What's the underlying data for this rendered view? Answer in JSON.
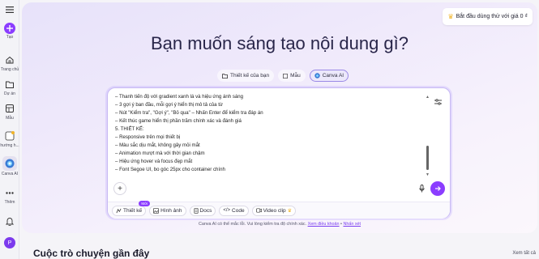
{
  "sidebar": {
    "items": [
      {
        "label": "Tạo",
        "icon": "plus-icon"
      },
      {
        "label": "Trang chủ",
        "icon": "home-icon"
      },
      {
        "label": "Dự án",
        "icon": "folder-icon"
      },
      {
        "label": "Mẫu",
        "icon": "template-icon"
      },
      {
        "label": "hướng h...",
        "icon": "brand-icon"
      },
      {
        "label": "Canva AI",
        "icon": "canva-ai-icon"
      },
      {
        "label": "Thêm",
        "icon": "more-icon"
      }
    ],
    "avatar_initial": "P"
  },
  "header": {
    "trial_button": "Bắt đầu dùng thử với giá 0 ₫",
    "title": "Bạn muốn sáng tạo nội dung gì?"
  },
  "tabs": [
    {
      "label": "Thiết kế của bạn"
    },
    {
      "label": "Mẫu"
    },
    {
      "label": "Canva AI"
    }
  ],
  "composer": {
    "lines": [
      "– Thanh tiến độ với gradient xanh lá và hiệu ứng ánh sáng",
      "– 3 gợi ý ban đầu, mỗi gợi ý hiển thị mô tả của từ",
      "– Nút \"Kiểm tra\", \"Gợi ý\", \"Bỏ qua\" – Nhấn Enter để kiểm tra đáp án",
      "– Kết thúc game hiển thị phần trăm chính xác và đánh giá",
      "5. THIẾT KẾ:",
      "– Responsive trên mọi thiết bị",
      "– Màu sắc dịu mắt, không gây mỏi mắt",
      "– Animation mượt mà với thời gian chậm",
      "– Hiệu ứng hover và focus đẹp mắt",
      "– Font Segoe UI, bo góc 25px cho container chính"
    ],
    "chips": [
      {
        "label": "Thiết kế",
        "badge": "Mới"
      },
      {
        "label": "Hình ảnh"
      },
      {
        "label": "Docs"
      },
      {
        "label": "Code"
      },
      {
        "label": "Video clip"
      }
    ]
  },
  "disclaimer": {
    "text": "Canva AI có thể mắc lỗi. Vui lòng kiểm tra độ chính xác.",
    "link1": "Xem điều khoản",
    "sep": " • ",
    "link2": "Nhấn xét"
  },
  "recent": {
    "title": "Cuộc trò chuyện gần đây",
    "see_all": "Xem tất cả"
  },
  "colors": {
    "accent": "#8b3dff",
    "crown": "#f0b429"
  }
}
